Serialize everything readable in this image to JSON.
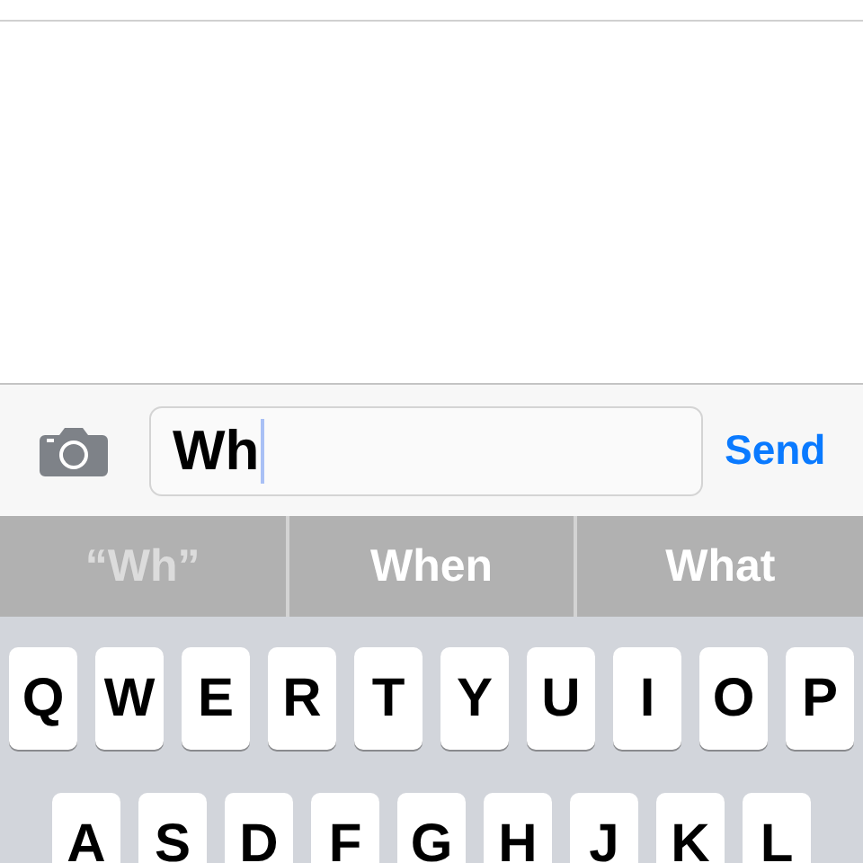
{
  "composer": {
    "message": {
      "value": "Wh"
    },
    "send_button": "Send"
  },
  "suggestions": [
    {
      "label": "“Wh”",
      "kind": "literal"
    },
    {
      "label": "When",
      "kind": "word"
    },
    {
      "label": "What",
      "kind": "word"
    }
  ],
  "keyboard": {
    "rows": [
      [
        "Q",
        "W",
        "E",
        "R",
        "T",
        "Y",
        "U",
        "I",
        "O",
        "P"
      ],
      [
        "A",
        "S",
        "D",
        "F",
        "G",
        "H",
        "J",
        "K",
        "L"
      ]
    ]
  }
}
